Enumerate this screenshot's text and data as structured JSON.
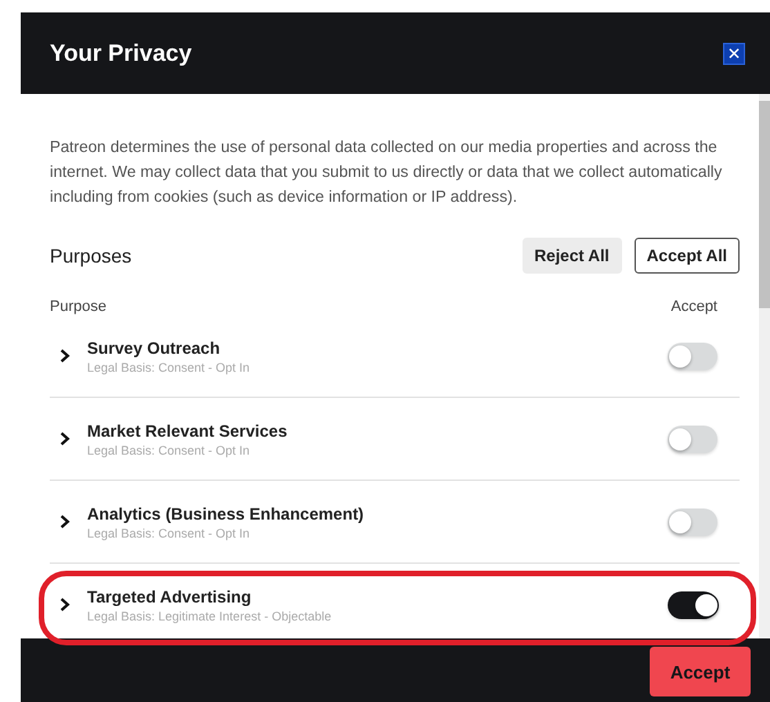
{
  "dialog": {
    "title": "Your Privacy",
    "close_label": "✕"
  },
  "intro": "Patreon determines the use of personal data collected on our media properties and across the internet. We may collect data that you submit to us directly or data that we collect automatically including from cookies (such as device information or IP address).",
  "purposes": {
    "heading": "Purposes",
    "buttons": [
      {
        "label": "Reject All",
        "kind": "filled"
      },
      {
        "label": "Accept All",
        "kind": "outline"
      }
    ],
    "columns": [
      "Purpose",
      "Accept"
    ],
    "rows": [
      {
        "name": "Survey Outreach",
        "basis": "Legal Basis: Consent - Opt In",
        "on": false,
        "highlighted": false
      },
      {
        "name": "Market Relevant Services",
        "basis": "Legal Basis: Consent - Opt In",
        "on": false,
        "highlighted": false
      },
      {
        "name": "Analytics (Business Enhancement)",
        "basis": "Legal Basis: Consent - Opt In",
        "on": false,
        "highlighted": false
      },
      {
        "name": "Targeted Advertising",
        "basis": "Legal Basis: Legitimate Interest - Objectable",
        "on": true,
        "highlighted": true
      }
    ]
  },
  "footer": {
    "button": "Accept"
  }
}
